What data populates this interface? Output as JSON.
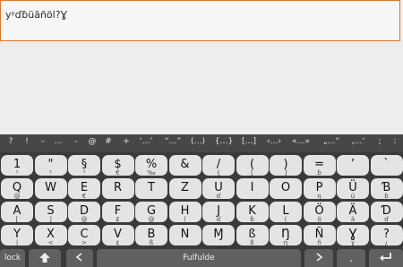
{
  "text_field": {
    "value": "yʸɗɓüãñöl?Ɣ"
  },
  "suggestions": [
    "?",
    "!",
    "–",
    "…",
    "-",
    "@",
    "#",
    "+",
    "‘…’",
    "“…”",
    "(…)",
    "{…}",
    "[…]",
    "‹…›",
    "«…»",
    "„…“",
    "‚…‘",
    ";",
    ":"
  ],
  "keyboard": {
    "rows": [
      [
        {
          "main": "1",
          "sub": "¹"
        },
        {
          "main": "\"",
          "sub": "²"
        },
        {
          "main": "§",
          "sub": "³"
        },
        {
          "main": "$",
          "sub": "€"
        },
        {
          "main": "%",
          "sub": "‰"
        },
        {
          "main": "&",
          "sub": ""
        },
        {
          "main": "/",
          "sub": "{"
        },
        {
          "main": "(",
          "sub": "["
        },
        {
          "main": ")",
          "sub": "]"
        },
        {
          "main": "=",
          "sub": "ɓ"
        },
        {
          "main": "’",
          "sub": ""
        },
        {
          "main": "`",
          "sub": ""
        }
      ],
      [
        {
          "main": "Q",
          "sub": "@"
        },
        {
          "main": "W",
          "sub": ""
        },
        {
          "main": "E",
          "sub": "€"
        },
        {
          "main": "R",
          "sub": ""
        },
        {
          "main": "T",
          "sub": ""
        },
        {
          "main": "Z",
          "sub": ""
        },
        {
          "main": "U",
          "sub": "ɗ"
        },
        {
          "main": "I",
          "sub": ""
        },
        {
          "main": "O",
          "sub": ""
        },
        {
          "main": "P",
          "sub": "ŋ"
        },
        {
          "main": "Ü",
          "sub": "ü"
        },
        {
          "main": "Ɓ",
          "sub": "ɓ"
        }
      ],
      [
        {
          "main": "A",
          "sub": "["
        },
        {
          "main": "S",
          "sub": "]"
        },
        {
          "main": "D",
          "sub": "@"
        },
        {
          "main": "F",
          "sub": "£"
        },
        {
          "main": "G",
          "sub": "@"
        },
        {
          "main": "H",
          "sub": "("
        },
        {
          "main": "J",
          "sub": "ɗ"
        },
        {
          "main": "K",
          "sub": "ɓ"
        },
        {
          "main": "L",
          "sub": "("
        },
        {
          "main": "Ö",
          "sub": "ö"
        },
        {
          "main": "Ä",
          "sub": "ä"
        },
        {
          "main": "Ɗ",
          "sub": "ɗ"
        }
      ],
      [
        {
          "main": "Y",
          "sub": "|"
        },
        {
          "main": "X",
          "sub": "<"
        },
        {
          "main": "C",
          "sub": ">"
        },
        {
          "main": "V",
          "sub": "¢"
        },
        {
          "main": "B",
          "sub": "ß"
        },
        {
          "main": "N",
          "sub": ""
        },
        {
          "main": "Ɱ",
          "sub": ""
        },
        {
          "main": "ß",
          "sub": "ß"
        },
        {
          "main": "Ŋ",
          "sub": "ŋ"
        },
        {
          "main": "Ñ",
          "sub": "ñ"
        },
        {
          "main": "Ɣ",
          "sub": "ɣ"
        },
        {
          "main": "?",
          "sub": "¿"
        }
      ]
    ],
    "bottom": {
      "lock_label": "lock",
      "space_label": "Fulfulde",
      "period_label": "."
    }
  },
  "colors": {
    "focus_border": "#d9772a",
    "bar": "#474747",
    "keyboard_bg": "#3a3a3a",
    "key_face": "#e4e4e4"
  },
  "icons": [
    "shift-icon",
    "left-arrow-icon",
    "right-arrow-icon",
    "enter-icon"
  ]
}
